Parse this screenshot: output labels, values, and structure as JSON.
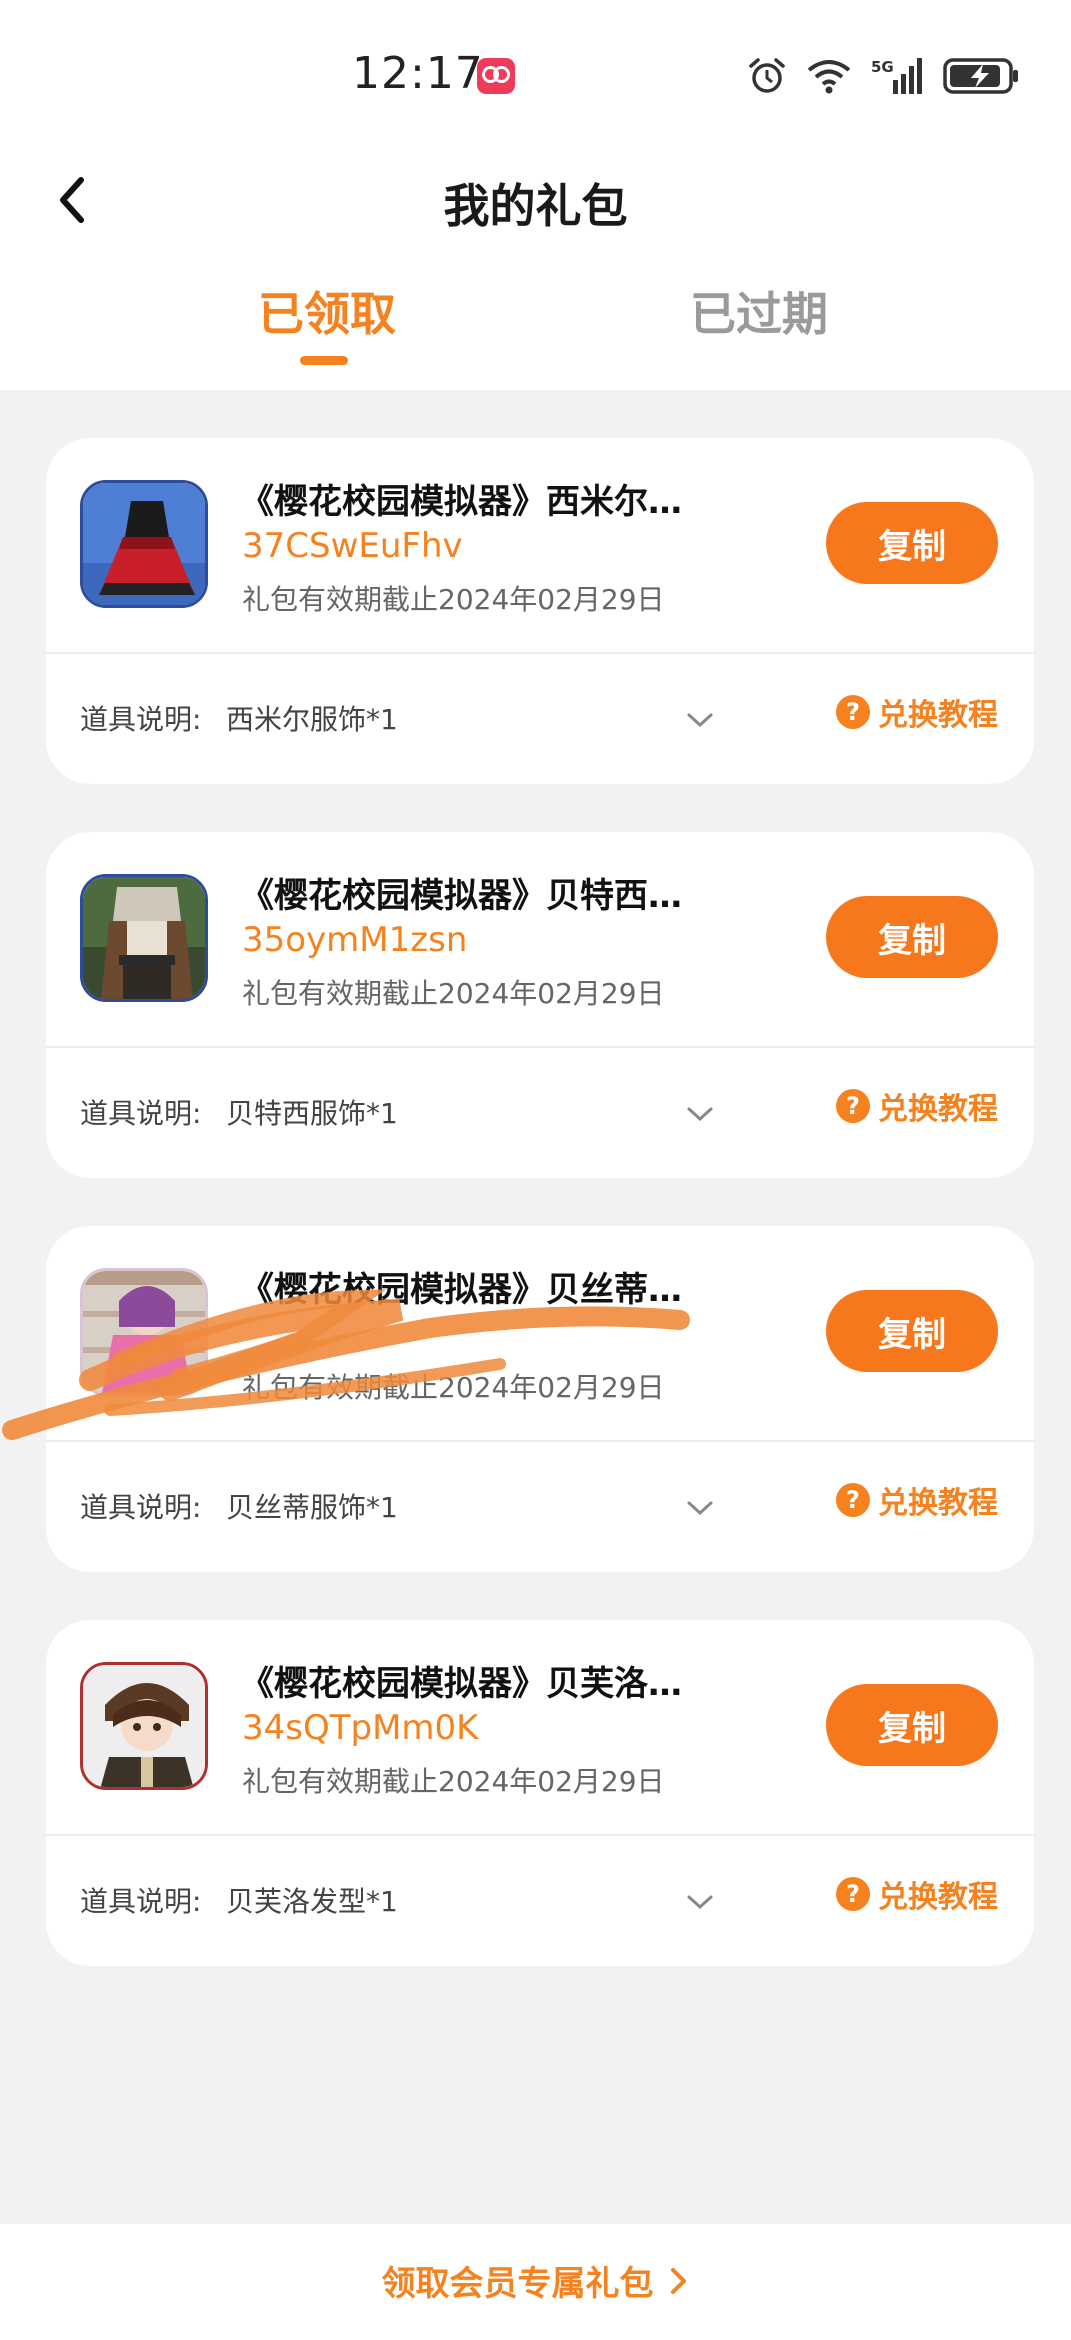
{
  "status_bar": {
    "time": "12:17",
    "network": "5G",
    "icons": [
      "app-badge-icon",
      "alarm-icon",
      "wifi-icon",
      "signal-5g-icon",
      "battery-charging-icon"
    ]
  },
  "header": {
    "title": "我的礼包",
    "back_icon": "back-arrow-icon"
  },
  "tabs": [
    {
      "label": "已领取",
      "active": true
    },
    {
      "label": "已过期",
      "active": false
    }
  ],
  "gifts": [
    {
      "title": "《樱花校园模拟器》西米尔…",
      "code": "37CSwEuFhv",
      "expiry": "礼包有效期截止2024年02月29日",
      "copy_label": "复制",
      "item_label": "道具说明:",
      "item_value": "西米尔服饰*1",
      "tutorial_label": "兑换教程"
    },
    {
      "title": "《樱花校园模拟器》贝特西…",
      "code": "35oymM1zsn",
      "expiry": "礼包有效期截止2024年02月29日",
      "copy_label": "复制",
      "item_label": "道具说明:",
      "item_value": "贝特西服饰*1",
      "tutorial_label": "兑换教程"
    },
    {
      "title": "《樱花校园模拟器》贝丝蒂…",
      "code": "",
      "expiry": "礼包有效期截止2024年02月29日",
      "copy_label": "复制",
      "item_label": "道具说明:",
      "item_value": "贝丝蒂服饰*1",
      "tutorial_label": "兑换教程"
    },
    {
      "title": "《樱花校园模拟器》贝芙洛…",
      "code": "34sQTpMm0K",
      "expiry": "礼包有效期截止2024年02月29日",
      "copy_label": "复制",
      "item_label": "道具说明:",
      "item_value": "贝芙洛发型*1",
      "tutorial_label": "兑换教程"
    }
  ],
  "footer": {
    "member_gift_label": "领取会员专属礼包"
  },
  "colors": {
    "accent": "#f5821f",
    "button": "#f7771c",
    "background": "#f2f2f4"
  }
}
